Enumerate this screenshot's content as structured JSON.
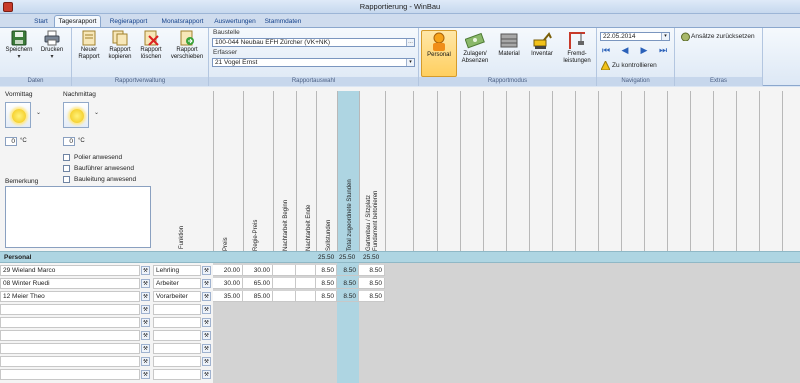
{
  "window": {
    "title": "Rapportierung - WinBau"
  },
  "tabs": [
    {
      "label": "Start"
    },
    {
      "label": "Tagesrapport"
    },
    {
      "label": "Regierapport"
    },
    {
      "label": "Monatsrapport"
    },
    {
      "label": "Auswertungen"
    },
    {
      "label": "Stammdaten"
    }
  ],
  "ribbon": {
    "daten": {
      "label": "Daten",
      "speichern": "Speichern",
      "drucken": "Drucken",
      "arrow": "▾"
    },
    "verwaltung": {
      "label": "Rapportverwaltung",
      "neuer_1": "Neuer",
      "neuer_2": "Rapport",
      "kop_1": "Rapport",
      "kop_2": "kopieren",
      "lo_1": "Rapport",
      "lo_2": "löschen",
      "ver_1": "Rapport",
      "ver_2": "verschieben"
    },
    "auswahl": {
      "label": "Rapportauswahl",
      "baustelle_label": "Baustelle",
      "baustelle_value": "100-044 Neubau EFH Zürcher (VK+NK)",
      "erfasser_label": "Erfasser",
      "erfasser_value": "21 Vogel Ernst",
      "ellipsis": "…",
      "dropdown": "▾"
    },
    "modus": {
      "label": "Rapportmodus",
      "personal": "Personal",
      "zulagen_1": "Zulagen/",
      "zulagen_2": "Absenzen",
      "material": "Material",
      "inventar": "Inventar",
      "fremd_1": "Fremd-",
      "fremd_2": "leistungen"
    },
    "navigation": {
      "label": "Navigation",
      "date": "22.05.2014",
      "first": "⏮",
      "prev": "◀",
      "next": "▶",
      "last": "⏭",
      "kontrollieren": "Zu kontrollieren"
    },
    "extras": {
      "label": "Extras",
      "ansaetze": "Ansätze zurücksetzen"
    }
  },
  "weather": {
    "vormittag": "Vormittag",
    "nachmittag": "Nachmittag",
    "temp_vm": "0",
    "temp_nm": "0",
    "unit": "°C",
    "drop": "⌄"
  },
  "checkboxes": [
    "Polier anwesend",
    "Bauführer anwesend",
    "Bauleitung anwesend"
  ],
  "bemerkung_label": "Bemerkung",
  "columns": {
    "funktion": "Funktion",
    "preis": "Preis",
    "regie_preis": "Regie-Preis",
    "nacht_beginn": "Nachtarbeit Beginn",
    "nacht_ende": "Nachtarbeit Ende",
    "sollstunden": "Sollstunden",
    "total": "Total zugeordnete Stunden",
    "gartenbau_1": "Gartenbau / Sitzplatz",
    "gartenbau_2": "Fundament betonieren"
  },
  "summary": {
    "label": "Personal",
    "soll": "25.50",
    "total": "25.50",
    "garten": "25.50"
  },
  "rows": [
    {
      "name": "29 Wieland Marco",
      "funktion": "Lehrling",
      "preis": "20.00",
      "regie": "30.00",
      "soll": "8.50",
      "total": "8.50",
      "garten": "8.50"
    },
    {
      "name": "08 Winter Ruedi",
      "funktion": "Arbeiter",
      "preis": "30.00",
      "regie": "65.00",
      "soll": "8.50",
      "total": "8.50",
      "garten": "8.50"
    },
    {
      "name": "12 Meier Theo",
      "funktion": "Vorarbeiter",
      "preis": "35.00",
      "regie": "85.00",
      "soll": "8.50",
      "total": "8.50",
      "garten": "8.50"
    }
  ],
  "wrench": "⚒"
}
